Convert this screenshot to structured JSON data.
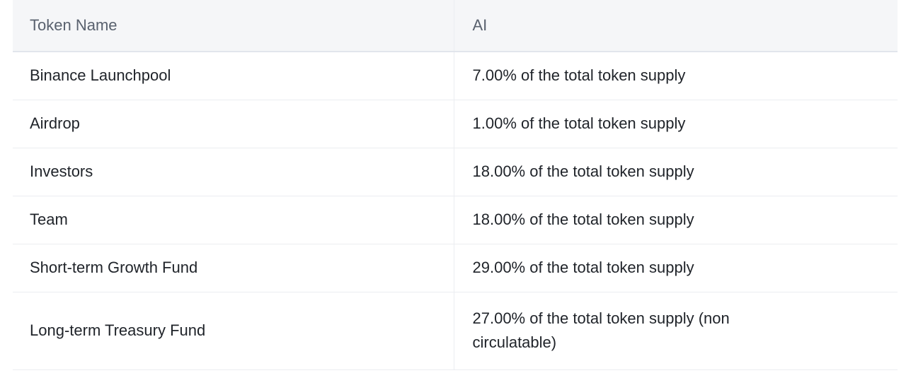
{
  "table": {
    "columns": [
      {
        "key": "name",
        "label": "Token Name"
      },
      {
        "key": "value",
        "label": "AI"
      }
    ],
    "rows": [
      {
        "name": "Binance Launchpool",
        "value": "7.00% of the total token supply"
      },
      {
        "name": "Airdrop",
        "value": "1.00% of the total token supply"
      },
      {
        "name": "Investors",
        "value": "18.00% of the total token supply"
      },
      {
        "name": "Team",
        "value": "18.00% of the total token supply"
      },
      {
        "name": "Short-term Growth Fund",
        "value": "29.00% of the total token supply"
      },
      {
        "name": "Long-term Treasury Fund",
        "value": "27.00% of the total token supply (non circulatable)"
      }
    ]
  },
  "colors": {
    "header_background": "#f5f6f8",
    "header_text": "#59616e",
    "body_text": "#1f2329",
    "row_divider": "#ebedf1",
    "header_divider": "#e2e5ec",
    "page_background": "#ffffff"
  }
}
